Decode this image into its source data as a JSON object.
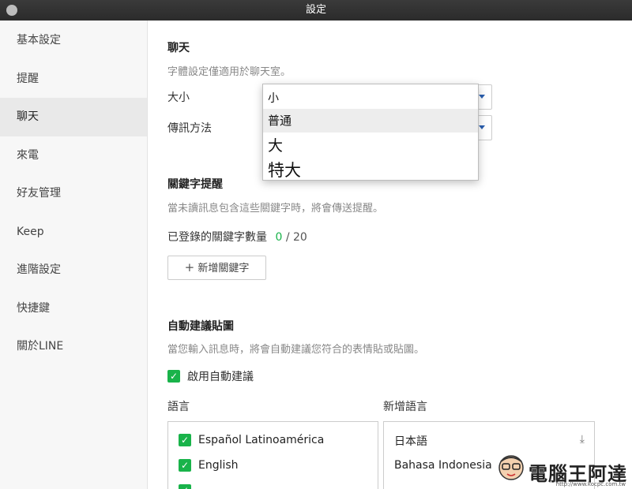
{
  "window": {
    "title": "設定"
  },
  "sidebar": {
    "items": [
      {
        "label": "基本設定"
      },
      {
        "label": "提醒"
      },
      {
        "label": "聊天"
      },
      {
        "label": "來電"
      },
      {
        "label": "好友管理"
      },
      {
        "label": "Keep"
      },
      {
        "label": "進階設定"
      },
      {
        "label": "快捷鍵"
      },
      {
        "label": "關於LINE"
      }
    ],
    "active_index": 2
  },
  "chat": {
    "title": "聊天",
    "desc": "字體設定僅適用於聊天室。",
    "size_label": "大小",
    "send_label": "傳訊方法",
    "size_dropdown": {
      "selected": "小",
      "options": [
        "普通",
        "大",
        "特大"
      ]
    }
  },
  "keyword": {
    "title": "關鍵字提醒",
    "desc": "當未讀訊息包含這些關鍵字時，將會傳送提醒。",
    "count_label": "已登錄的關鍵字數量",
    "count_value": "0",
    "count_max": "/ 20",
    "add_button": "新增關鍵字"
  },
  "sticker": {
    "title": "自動建議貼圖",
    "desc": "當您輸入訊息時，將會自動建議您符合的表情貼或貼圖。",
    "enable_label": "啟用自動建議",
    "lang_header": "語言",
    "add_lang_header": "新增語言",
    "languages": [
      "Español Latinoamérica",
      "English"
    ],
    "available_languages": [
      "日本語",
      "Bahasa Indonesia"
    ]
  },
  "watermark": {
    "text": "電腦王阿達",
    "url": "http://www.kocpc.com.tw"
  },
  "colors": {
    "accent_green": "#19b34a",
    "titlebar": "#2e2e2e"
  }
}
